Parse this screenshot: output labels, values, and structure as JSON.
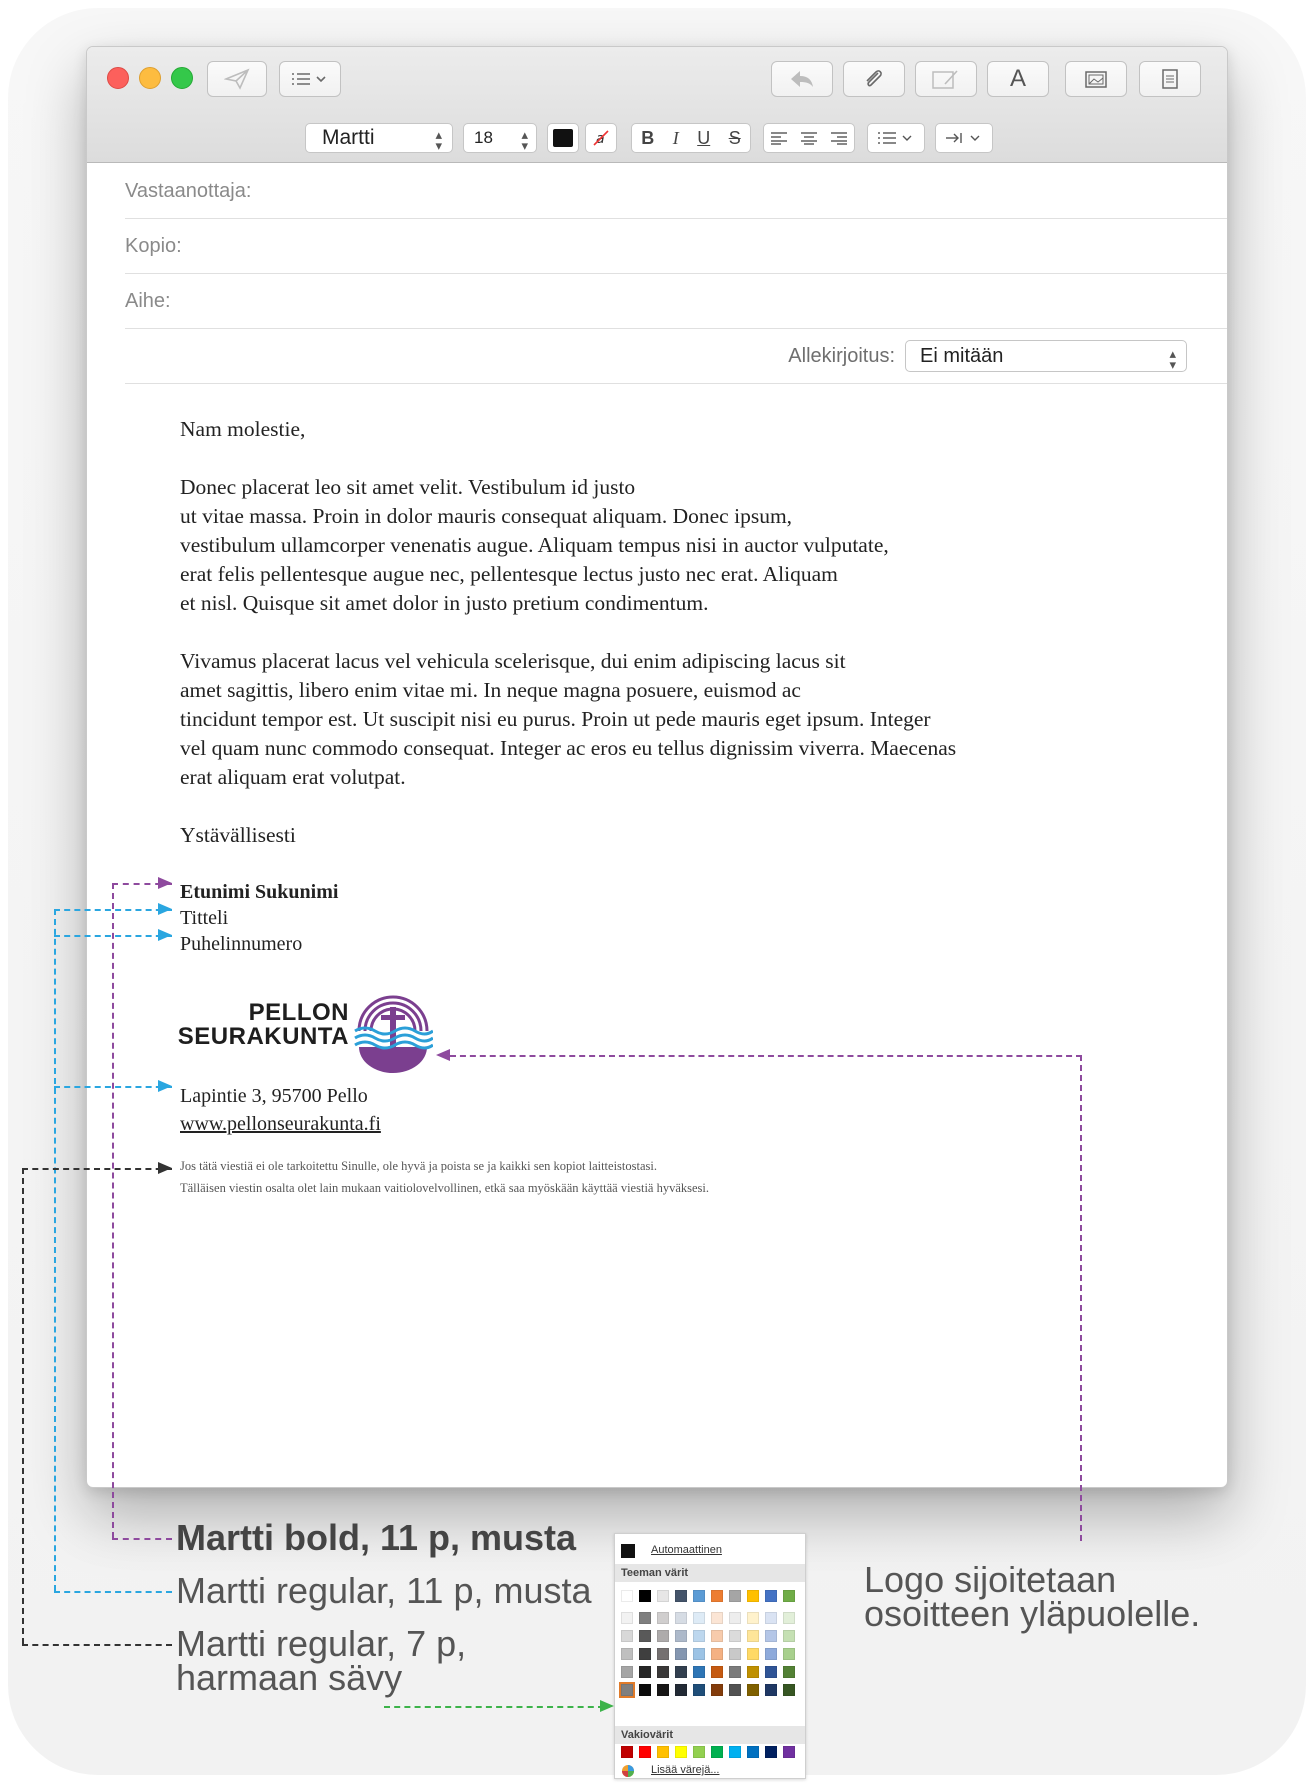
{
  "window": {
    "toolbar_icons": [
      "send-icon",
      "header-list-icon",
      "reply-icon",
      "attach-icon",
      "markup-icon",
      "font-icon",
      "photo-icon",
      "stationery-icon"
    ],
    "font_icon_glyph": "A"
  },
  "format_bar": {
    "font": "Martti",
    "size": "18",
    "bold": "B",
    "italic": "I",
    "underline": "U",
    "strike": "S"
  },
  "header": {
    "to_label": "Vastaanottaja:",
    "cc_label": "Kopio:",
    "subject_label": "Aihe:",
    "signature_label": "Allekirjoitus:",
    "signature_value": "Ei mitään"
  },
  "body": {
    "greeting": "Nam molestie,",
    "para1": [
      "Donec placerat leo sit amet velit. Vestibulum id justo",
      "ut vitae massa. Proin in dolor mauris consequat aliquam. Donec ipsum,",
      "vestibulum ullamcorper venenatis augue. Aliquam tempus nisi in auctor vulputate,",
      "erat felis pellentesque augue nec, pellentesque lectus justo nec erat. Aliquam",
      "et nisl. Quisque sit amet dolor in justo pretium condimentum."
    ],
    "para2": [
      "Vivamus placerat lacus vel vehicula scelerisque, dui enim adipiscing lacus sit",
      "amet sagittis, libero enim vitae mi. In neque magna posuere, euismod ac",
      "tincidunt tempor est. Ut suscipit nisi eu purus. Proin ut pede mauris eget ipsum. Integer",
      "vel quam nunc commodo consequat. Integer ac eros eu tellus dignissim viverra. Maecenas",
      "erat aliquam erat volutpat."
    ],
    "closing": "Ystävällisesti"
  },
  "signature": {
    "name": "Etunimi Sukunimi",
    "title": "Titteli",
    "phone": "Puhelinnumero",
    "logo_line1": "PELLON",
    "logo_line2": "SEURAKUNTA",
    "address": "Lapintie 3, 95700 Pello",
    "website": "www.pellonseurakunta.fi",
    "disclaimer1": "Jos tätä viestiä ei ole tarkoitettu Sinulle, ole hyvä ja poista se ja kaikki sen kopiot laitteistostasi.",
    "disclaimer2": "Tälläisen viestin osalta olet lain mukaan vaitiolovelvollinen, etkä saa myöskään käyttää viestiä hyväksesi."
  },
  "annotations": {
    "bold_caption": "Martti bold, 11 p, musta",
    "regular_caption": "Martti regular, 11 p, musta",
    "small_caption_1": "Martti regular, 7 p,",
    "small_caption_2": "harmaan sävy",
    "logo_caption_1": "Logo sijoitetaan",
    "logo_caption_2": "osoitteen yläpuolelle."
  },
  "color_picker": {
    "automatic": "Automaattinen",
    "theme_colors": "Teeman värit",
    "standard_colors": "Vakiovärit",
    "more_colors": "Lisää värejä..."
  },
  "colors": {
    "annot_purple": "#8e4a9e",
    "annot_blue": "#2aa6e0",
    "annot_black": "#333333",
    "annot_green": "#3db34a",
    "logo_purple": "#7b3f8f",
    "logo_blue": "#2b9fd8"
  }
}
